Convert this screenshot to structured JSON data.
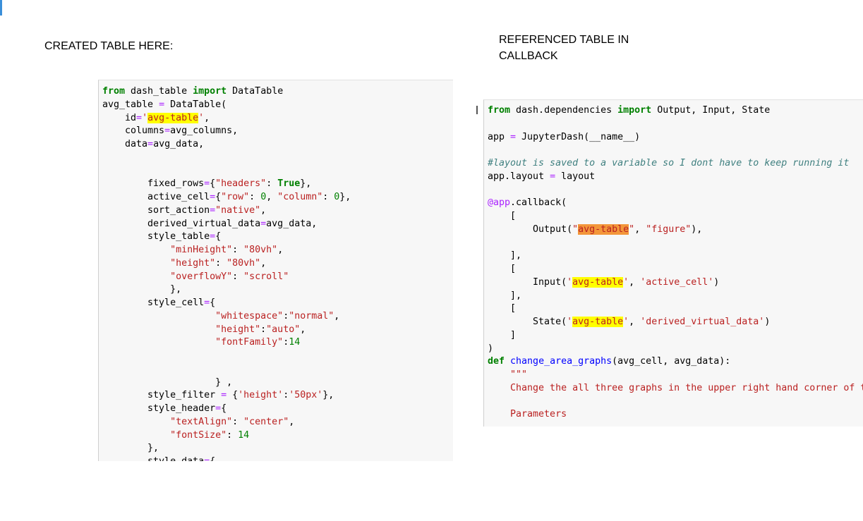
{
  "captions": {
    "left": "CREATED TABLE HERE:",
    "right": "REFERENCED TABLE IN CALLBACK"
  },
  "left_code": {
    "l1_from": "from",
    "l1_module": " dash_table ",
    "l1_import": "import",
    "l1_name": " DataTable",
    "l2_var": "avg_table ",
    "l2_eq": "=",
    "l2_call": " DataTable(",
    "l3_indent": "    id",
    "l3_eq": "=",
    "l3_q1": "'",
    "l3_val": "avg-table",
    "l3_q2": "'",
    "l3_comma": ",",
    "l4_indent": "    columns",
    "l4_eq": "=",
    "l4_val": "avg_columns,",
    "l5_indent": "    data",
    "l5_eq": "=",
    "l5_val": "avg_data,",
    "l8_a": "        fixed_rows",
    "l8_eq": "=",
    "l8_b": "{",
    "l8_key": "\"headers\"",
    "l8_c": ": ",
    "l8_val": "True",
    "l8_d": "},",
    "l9_a": "        active_cell",
    "l9_eq": "=",
    "l9_b": "{",
    "l9_k1": "\"row\"",
    "l9_c": ": ",
    "l9_v1": "0",
    "l9_d": ", ",
    "l9_k2": "\"column\"",
    "l9_e": ": ",
    "l9_v2": "0",
    "l9_f": "},",
    "l10_a": "        sort_action",
    "l10_eq": "=",
    "l10_val": "\"native\"",
    "l10_b": ",",
    "l11_a": "        derived_virtual_data",
    "l11_eq": "=",
    "l11_b": "avg_data,",
    "l12_a": "        style_table",
    "l12_eq": "=",
    "l12_b": "{",
    "l13_a": "            ",
    "l13_key": "\"minHeight\"",
    "l13_b": ": ",
    "l13_val": "\"80vh\"",
    "l13_c": ",",
    "l14_a": "            ",
    "l14_key": "\"height\"",
    "l14_b": ": ",
    "l14_val": "\"80vh\"",
    "l14_c": ",",
    "l15_a": "            ",
    "l15_key": "\"overflowY\"",
    "l15_b": ": ",
    "l15_val": "\"scroll\"",
    "l16": "            },",
    "l17_a": "        style_cell",
    "l17_eq": "=",
    "l17_b": "{",
    "l18_a": "                    ",
    "l18_key": "\"whitespace\"",
    "l18_b": ":",
    "l18_val": "\"normal\"",
    "l18_c": ",",
    "l19_a": "                    ",
    "l19_key": "\"height\"",
    "l19_b": ":",
    "l19_val": "\"auto\"",
    "l19_c": ",",
    "l20_a": "                    ",
    "l20_key": "\"fontFamily\"",
    "l20_b": ":",
    "l20_val": "14",
    "l23": "                    } ,",
    "l24_a": "        style_filter ",
    "l24_eq": "=",
    "l24_b": " {",
    "l24_key": "'height'",
    "l24_c": ":",
    "l24_val": "'50px'",
    "l24_d": "},",
    "l25_a": "        style_header",
    "l25_eq": "=",
    "l25_b": "{",
    "l26_a": "            ",
    "l26_key": "\"textAlign\"",
    "l26_b": ": ",
    "l26_val": "\"center\"",
    "l26_c": ",",
    "l27_a": "            ",
    "l27_key": "\"fontSize\"",
    "l27_b": ": ",
    "l27_val": "14",
    "l28": "        },",
    "l29_a": "        style_data",
    "l29_eq": "=",
    "l29_b": "{"
  },
  "right_code": {
    "r1_from": "from",
    "r1_mod": " dash.dependencies ",
    "r1_import": "import",
    "r1_names": " Output, Input, State",
    "r3_a": "app ",
    "r3_eq": "=",
    "r3_b": " JupyterDash(",
    "r3_dunder": "__name__",
    "r3_c": ")",
    "r5_comment": "#layout is saved to a variable so I dont have to keep running it",
    "r6_a": "app",
    "r6_b": ".layout ",
    "r6_eq": "=",
    "r6_c": " layout",
    "r8_dec": "@app",
    "r8_b": ".callback(",
    "r9": "    [",
    "r10_a": "        Output(",
    "r10_q1": "\"",
    "r10_val": "avg-table",
    "r10_q2": "\"",
    "r10_b": ", ",
    "r10_str": "\"figure\"",
    "r10_c": "),",
    "r12": "    ],",
    "r13": "    [",
    "r14_a": "        Input(",
    "r14_q1": "'",
    "r14_val": "avg-table",
    "r14_q2": "'",
    "r14_b": ", ",
    "r14_str": "'active_cell'",
    "r14_c": ")",
    "r15": "    ],",
    "r16": "    [",
    "r17_a": "        State(",
    "r17_q1": "'",
    "r17_val": "avg-table",
    "r17_q2": "'",
    "r17_b": ", ",
    "r17_str": "'derived_virtual_data'",
    "r17_c": ")",
    "r18": "    ]",
    "r19": ")",
    "r20_def": "def",
    "r20_fn": " change_area_graphs",
    "r20_b": "(avg_cell, avg_data):",
    "r21_doc": "    \"\"\"",
    "r22_doc": "    Change the all three graphs in the upper right hand corner of the app",
    "r24_doc": "    Parameters"
  }
}
